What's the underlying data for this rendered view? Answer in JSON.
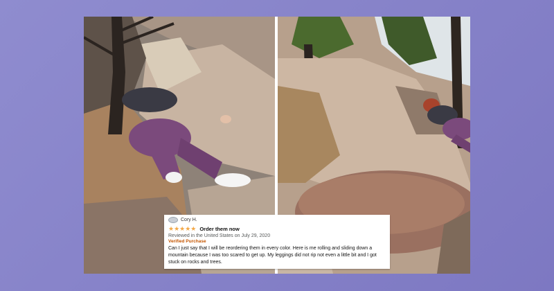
{
  "review": {
    "reviewer": "Cory H.",
    "stars": "★★★★★",
    "title": "Order them now",
    "meta": "Reviewed in the United States on July 29, 2020",
    "verified": "Verified Purchase",
    "body": "Can I just say that I will be reordering them in every color. Here is me rolling and sliding down a mountain because I was too scared to get up. My leggings did not rip not even a little bit and I got stuck on rocks and trees."
  },
  "colors": {
    "background": "#8a86cb",
    "leggings": "#7b4a7c",
    "rock": "#b89a80",
    "star": "#f3a847",
    "verified": "#c45500"
  }
}
